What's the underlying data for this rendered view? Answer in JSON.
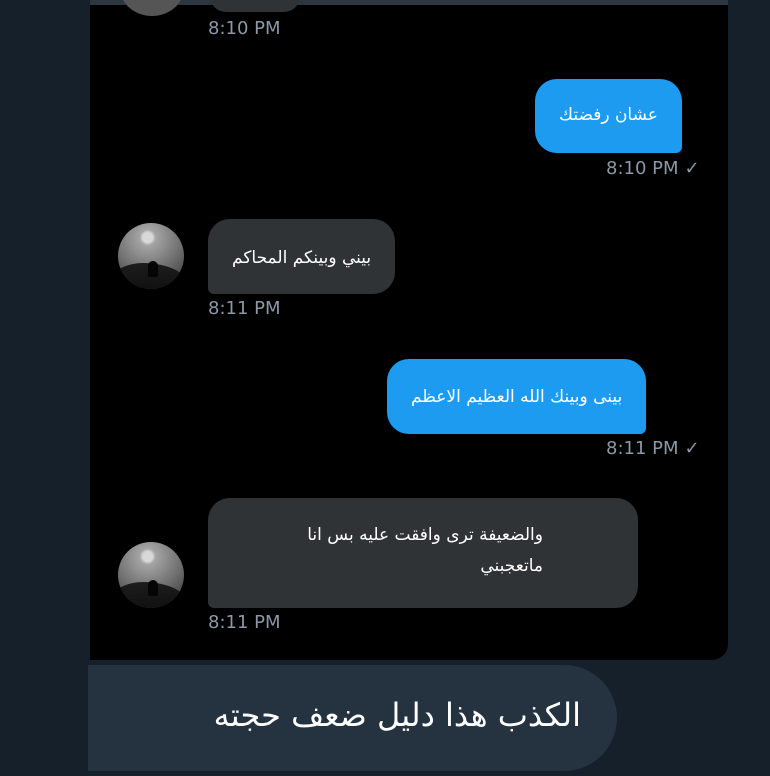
{
  "messages": [
    {
      "time": "8:10 PM"
    },
    {
      "text": "عشان رفضتك",
      "time": "8:10 PM",
      "check": "✓"
    },
    {
      "text": "بيني وبينكم المحاكم",
      "time": "8:11 PM"
    },
    {
      "text": "بينى وبينك الله العظيم الاعظم",
      "time": "8:11 PM",
      "check": "✓"
    },
    {
      "line1": "والضعيفة ترى وافقت عليه بس انا",
      "line2": "ماتعجبني",
      "time": "8:11 PM"
    }
  ],
  "caption": "الكذب هذا دليل ضعف حجته",
  "icons": {
    "avatar": "avatar-image",
    "check": "check-icon"
  },
  "colors": {
    "background": "#15202b",
    "chat_background": "#000000",
    "outgoing_bubble": "#1d9bf0",
    "incoming_bubble": "#2f3336",
    "timestamp": "#8b98a5",
    "caption_background": "#253341"
  }
}
